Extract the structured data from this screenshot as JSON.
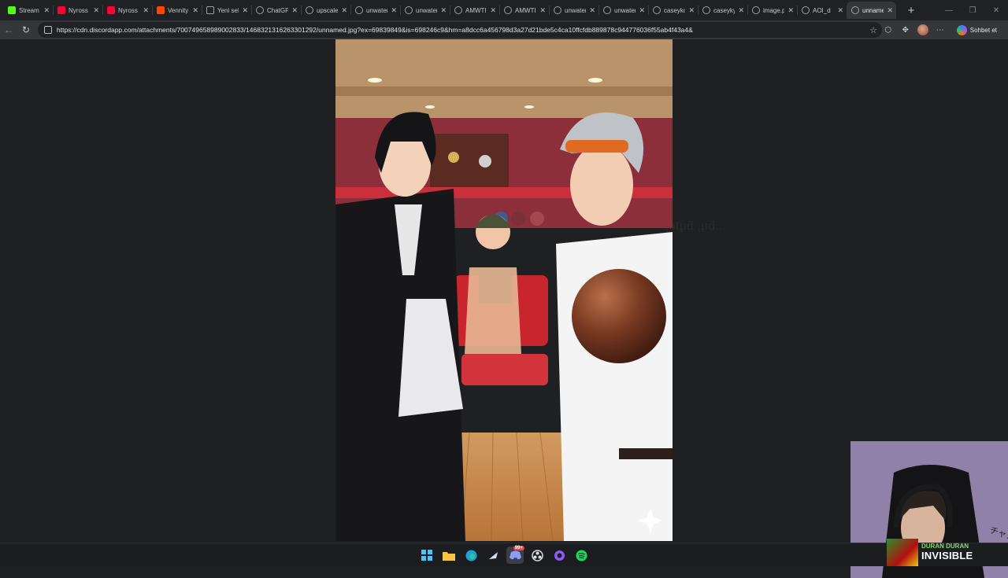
{
  "browser": {
    "tabs": [
      {
        "label": "Stream",
        "icon": "kick-icon",
        "color": "#53fc18"
      },
      {
        "label": "Nyross",
        "icon": "youtube-icon",
        "color": "#ff0033"
      },
      {
        "label": "Nyross",
        "icon": "youtube-icon",
        "color": "#ff0033"
      },
      {
        "label": "Vennity",
        "icon": "reddit-icon",
        "color": "#ff4500"
      },
      {
        "label": "Yeni sek",
        "icon": "document-icon",
        "color": "#9aa0a6"
      },
      {
        "label": "ChatGP",
        "icon": "globe-icon",
        "color": "#9aa0a6"
      },
      {
        "label": "upscale",
        "icon": "globe-icon",
        "color": "#9aa0a6"
      },
      {
        "label": "unwater",
        "icon": "globe-icon",
        "color": "#9aa0a6"
      },
      {
        "label": "unwater",
        "icon": "globe-icon",
        "color": "#9aa0a6"
      },
      {
        "label": "AMWTI",
        "icon": "globe-icon",
        "color": "#9aa0a6"
      },
      {
        "label": "AMWTI",
        "icon": "globe-icon",
        "color": "#9aa0a6"
      },
      {
        "label": "unwater",
        "icon": "globe-icon",
        "color": "#9aa0a6"
      },
      {
        "label": "unwater",
        "icon": "globe-icon",
        "color": "#9aa0a6"
      },
      {
        "label": "caseyko",
        "icon": "globe-icon",
        "color": "#9aa0a6"
      },
      {
        "label": "caseyky",
        "icon": "globe-icon",
        "color": "#9aa0a6"
      },
      {
        "label": "image.p",
        "icon": "globe-icon",
        "color": "#9aa0a6"
      },
      {
        "label": "AOI_d",
        "icon": "globe-icon",
        "color": "#9aa0a6"
      },
      {
        "label": "unname",
        "icon": "globe-icon",
        "color": "#9aa0a6",
        "active": true
      }
    ],
    "url": "https://cdn.discordapp.com/attachments/700749658989002833/1468321316263301292/unnamed.jpg?ex=69839849&is=698246c9&hm=a8dcc6a456798d3a27d21bde5c4ca10ffcfdb889878c944776036f55ab4f43a4&",
    "copilot_label": "Sohbet et"
  },
  "page": {
    "ghost_text": "...ƃıɟ, ƃıɟʇǝp"
  },
  "taskbar": {
    "discord_badge": "99+",
    "apps": [
      "windows-start-icon",
      "file-explorer-icon",
      "edge-icon",
      "steam-icon",
      "discord-icon",
      "obs-icon",
      "app-icon",
      "spotify-icon"
    ]
  },
  "now_playing": {
    "artist": "DURAN DURAN",
    "title": "INVISIBLE"
  },
  "colors": {
    "page_bg": "#1f2022",
    "tabstrip_bg": "#202124",
    "toolbar_bg": "#35363a",
    "artist_green": "#8bd66b"
  }
}
